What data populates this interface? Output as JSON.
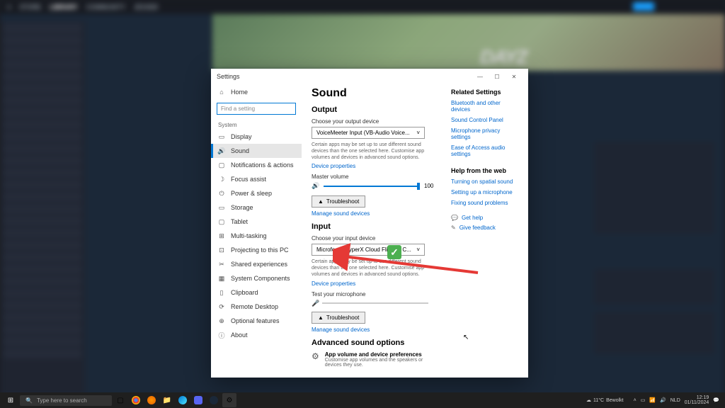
{
  "steam": {
    "nav": {
      "store": "STORE",
      "library": "LIBRARY",
      "community": "COMMUNITY",
      "user": "JESSE8"
    },
    "game_logo": "DAYZ"
  },
  "settings": {
    "window_title": "Settings",
    "titlebar": {
      "min": "—",
      "max": "☐",
      "close": "✕"
    },
    "home": "Home",
    "search_placeholder": "Find a setting",
    "category": "System",
    "nav": {
      "display": "Display",
      "sound": "Sound",
      "notifications": "Notifications & actions",
      "focus": "Focus assist",
      "power": "Power & sleep",
      "storage": "Storage",
      "tablet": "Tablet",
      "multitask": "Multi-tasking",
      "projecting": "Projecting to this PC",
      "shared": "Shared experiences",
      "components": "System Components",
      "clipboard": "Clipboard",
      "remote": "Remote Desktop",
      "optional": "Optional features",
      "about": "About"
    },
    "page_title": "Sound",
    "output": {
      "heading": "Output",
      "choose_label": "Choose your output device",
      "device": "VoiceMeeter Input (VB-Audio Voice...",
      "desc": "Certain apps may be set up to use different sound devices than the one selected here. Customise app volumes and devices in advanced sound options.",
      "device_props": "Device properties",
      "master_volume": "Master volume",
      "volume_value": "100",
      "troubleshoot": "Troubleshoot",
      "manage": "Manage sound devices"
    },
    "input": {
      "heading": "Input",
      "choose_label": "Choose your input device",
      "device": "Microfoon (HyperX Cloud Flight S C...",
      "desc": "Certain apps may be set up to use different sound devices than the one selected here. Customise app volumes and devices in advanced sound options.",
      "device_props": "Device properties",
      "test_label": "Test your microphone",
      "troubleshoot": "Troubleshoot",
      "manage": "Manage sound devices"
    },
    "advanced": {
      "heading": "Advanced sound options",
      "pref_title": "App volume and device preferences",
      "pref_desc": "Customise app volumes and the speakers or devices they use."
    },
    "related": {
      "heading": "Related Settings",
      "bluetooth": "Bluetooth and other devices",
      "control_panel": "Sound Control Panel",
      "privacy": "Microphone privacy settings",
      "ease": "Ease of Access audio settings"
    },
    "help": {
      "heading": "Help from the web",
      "spatial": "Turning on spatial sound",
      "setup_mic": "Setting up a microphone",
      "fixing": "Fixing sound problems",
      "get_help": "Get help",
      "feedback": "Give feedback"
    }
  },
  "taskbar": {
    "search": "Type here to search",
    "weather_temp": "11°C",
    "weather_cond": "Bewolkt",
    "lang": "NLD",
    "time": "12:19",
    "date": "01/11/2024"
  }
}
